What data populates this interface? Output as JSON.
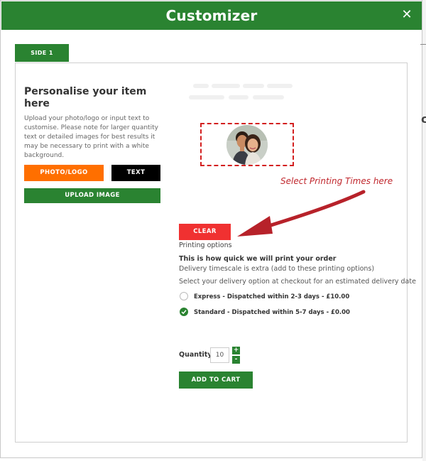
{
  "header": {
    "title": "Customizer",
    "close_symbol": "✕"
  },
  "tabs": [
    {
      "label": "SIDE 1",
      "active": true
    }
  ],
  "left": {
    "title": "Personalise your item here",
    "description": "Upload your photo/logo or input text to customise. Please note for larger quantity text or detailed images for best results it may be necessary to print with a white background.",
    "buttons": {
      "photo_logo": "PHOTO/LOGO",
      "text": "TEXT",
      "upload_image": "UPLOAD IMAGE"
    }
  },
  "preview": {
    "annotation": "Select Printing Times here"
  },
  "clear_label": "CLEAR",
  "printing": {
    "label": "Printing options",
    "heading": "This is how quick we will print your order",
    "subheading": "Delivery timescale is extra (add to these printing options)",
    "select_hint": "Select your delivery option at checkout for an estimated delivery date",
    "options": [
      {
        "label": "Express - Dispatched within 2-3 days - £10.00",
        "selected": false
      },
      {
        "label": "Standard - Dispatched within 5-7 days - £0.00",
        "selected": true
      }
    ]
  },
  "quantity": {
    "label": "Quantity",
    "value": "10",
    "plus": "+",
    "minus": "-"
  },
  "cart_label": "ADD TO CART",
  "colors": {
    "brand_green": "#2a8331",
    "orange": "#ff6f00",
    "clear_red": "#f03131",
    "annotation_red": "#c0272d"
  }
}
